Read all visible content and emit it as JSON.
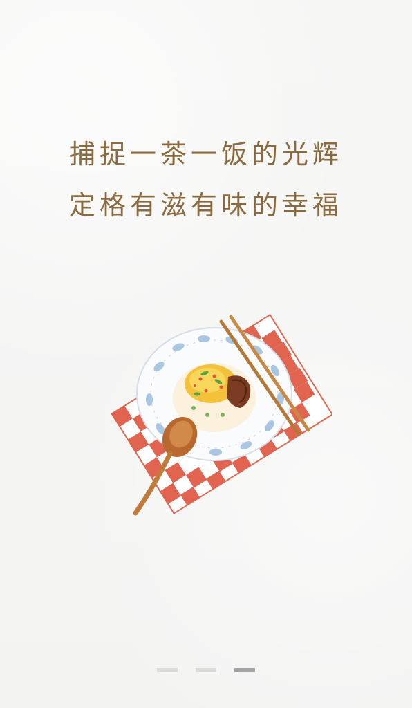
{
  "splash": {
    "line1": "捕捉一茶一饭的光辉",
    "line2": "定格有滋有味的幸福"
  },
  "illustration": {
    "icon": "meal-plate-illustration"
  },
  "pager": {
    "count": 3,
    "active_index": 2
  },
  "colors": {
    "background": "#f5f5f4",
    "text": "#8a6a3f",
    "dot_inactive": "#dcdcdc",
    "dot_active": "#a3a3a3"
  }
}
